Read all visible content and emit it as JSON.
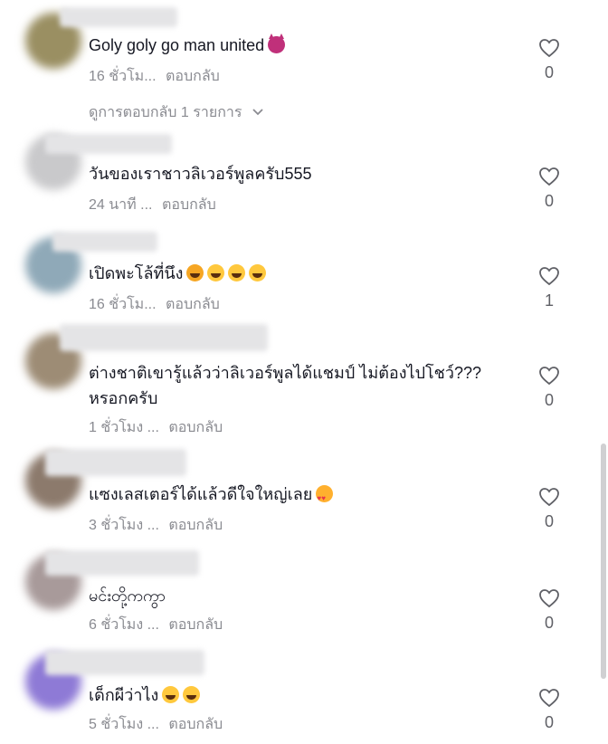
{
  "comments": [
    {
      "text": "Goly goly go man united",
      "emoji": [
        "devil"
      ],
      "time": "16 ชั่วโม...",
      "reply": "ตอบกลับ",
      "likes": "0",
      "view_replies": "ดูการตอบกลับ 1 รายการ",
      "avatar_color": "#9a8f62"
    },
    {
      "text": "วันของเราชาวลิเวอร์พูลครับ555",
      "emoji": [],
      "time": "24 นาที ...",
      "reply": "ตอบกลับ",
      "likes": "0",
      "avatar_color": "#c9c9cb"
    },
    {
      "text": "เปิดพะโล้ที่นึง",
      "emoji": [
        "hug",
        "laugh",
        "grimace",
        "rofl"
      ],
      "time": "16 ชั่วโม...",
      "reply": "ตอบกลับ",
      "likes": "1",
      "avatar_color": "#8fa9b8"
    },
    {
      "text": "ต่างชาติเขารู้แล้วว่าลิเวอร์พูลได้แชมป์ ไม่ต้องไปโชว์??? หรอกครับ",
      "emoji": [],
      "time": "1 ชั่วโมง ...",
      "reply": "ตอบกลับ",
      "likes": "0",
      "avatar_color": "#9d8c75"
    },
    {
      "text": "แซงเลสเตอร์ได้แล้วดีใจใหญ่เลย",
      "emoji": [
        "hearteyes"
      ],
      "time": "3 ชั่วโมง ...",
      "reply": "ตอบกลับ",
      "likes": "0",
      "avatar_color": "#8c7a6c"
    },
    {
      "text": "မင်းတို့ကကွာ",
      "emoji": [],
      "time": "6 ชั่วโมง ...",
      "reply": "ตอบกลับ",
      "likes": "0",
      "avatar_color": "#a89a9a"
    },
    {
      "text": "เด็กผีว่าไง",
      "emoji": [
        "laugh",
        "laugh"
      ],
      "time": "5 ชั่วโมง ...",
      "reply": "ตอบกลับ",
      "likes": "0",
      "avatar_color": "#8e7ad6"
    }
  ],
  "icons": {
    "like": "heart-outline-icon",
    "expand": "chevron-down-icon"
  }
}
